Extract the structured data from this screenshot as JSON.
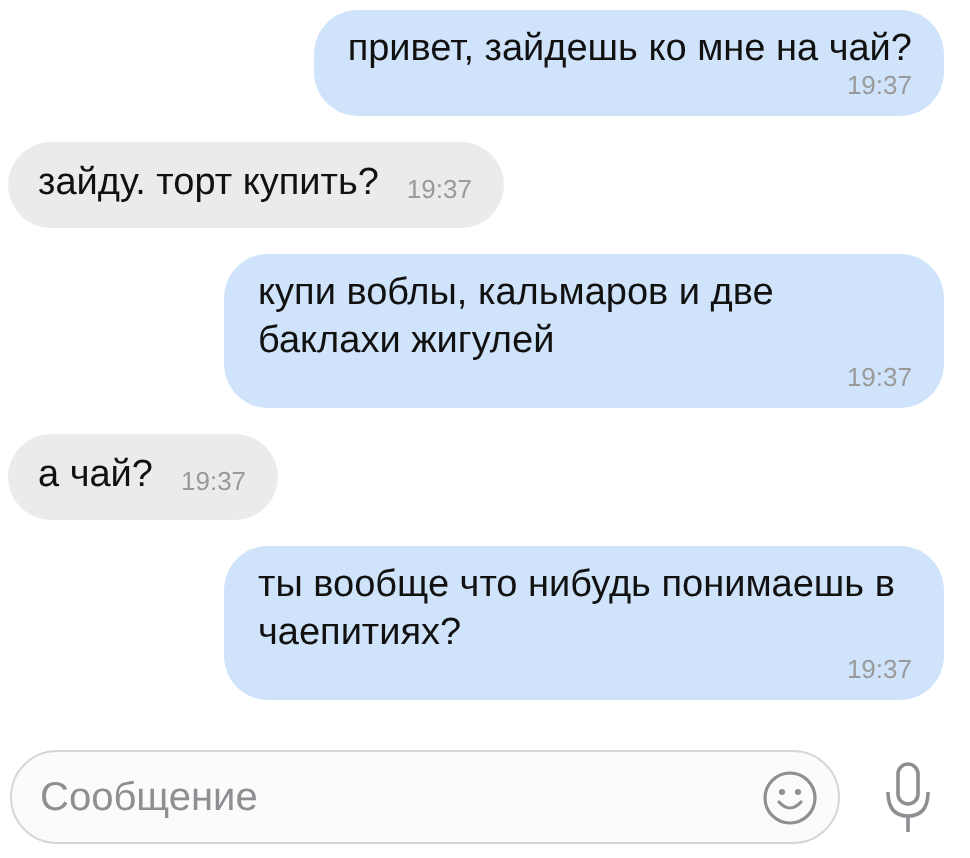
{
  "messages": [
    {
      "kind": "outgoing",
      "text": "привет, зайдешь ко мне на чай?",
      "time": "19:37"
    },
    {
      "kind": "incoming",
      "text": "зайду. торт купить?",
      "time": "19:37"
    },
    {
      "kind": "outgoing",
      "text": "купи воблы, кальмаров и две баклахи жигулей",
      "time": "19:37"
    },
    {
      "kind": "incoming",
      "text": "а чай?",
      "time": "19:37"
    },
    {
      "kind": "outgoing",
      "text": "ты вообще что нибудь понимаешь в чаепитиях?",
      "time": "19:37"
    }
  ],
  "composer": {
    "placeholder": "Сообщение"
  }
}
